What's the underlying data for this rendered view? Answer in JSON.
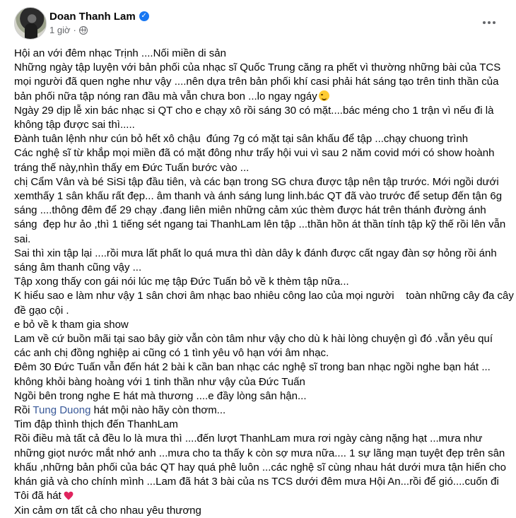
{
  "author": {
    "name": "Doan Thanh Lam",
    "time": "1 giờ",
    "separator": "·"
  },
  "icons": {
    "verified": "verified-badge-icon",
    "privacy": "globe-icon",
    "more": "more-options-icon",
    "wink": "wink-emoji-icon",
    "heart": "red-heart-icon"
  },
  "colors": {
    "link": "#385898",
    "verified": "#1877f2",
    "meta": "#65676b"
  },
  "post": {
    "lines": [
      "Hội an với đêm nhạc Trịnh ....Nối miền di sản",
      "Những ngày tập luyện với bản phối của nhạc sĩ Quốc Trung căng ra phết vì thường những bài của TCS",
      "mọi người đã quen nghe như vậy ....nên dựa trên bản phối khí casi phải hát sáng tạo trên tinh thần của",
      "bản phối nữa tập nóng ran đầu mà vẫn chưa bon ...lo ngay ngáy",
      "Ngày 29 dịp lễ xin bác nhạc si QT cho e chạy xô rồi sáng 30 có mặt....bác méng cho 1 trận vì nếu đi là",
      "không tập được sai thì.....",
      "Đành tuân lệnh như cún bỏ hết xô chậu  đúng 7g có mặt tại sân khấu để tập ...chạy chuong trình",
      "Các nghệ sĩ từ khắp mọi miền đã có mặt đông như trẩy hội vui vì sau 2 năm covid mới có show hoành",
      "tráng thế này,nhìn thấy em Đức Tuấn bước vào ...",
      "chị Cẩm Vân và bé SiSi tập đầu tiên, và các bạn trong SG chưa được tập nên tập trước. Mới ngồi dưới",
      "xemthấy 1 sân khấu rất đẹp... âm thanh và ánh sáng lung linh.bác QT đã vào trước để setup đến tận 6g",
      "sáng ....thông đêm để 29 chạy .đang liên miên những cảm xúc thèm được hát trên thánh đường ánh",
      "sáng  đẹp hư ảo ,thì 1 tiếng sét ngang tai ThanhLam lên tập ...thần hồn át thần tính tập kỹ thế rồi lên vẫn",
      "sai.",
      "Sai thì xin tập lại ....rồi mưa lất phất lo quá mưa thì dàn dây k đánh được cất ngay đàn sợ hỏng rồi ánh",
      "sáng âm thanh cũng vậy ...",
      "Tập xong thấy con gái nói lúc mẹ tập Đức Tuấn bỏ về k thèm tập nữa...",
      "K hiểu sao e làm như vậy 1 sân chơi âm nhạc bao nhiêu công lao của mọi người    toàn những cây đa cây",
      "đề gạo cội .",
      "e bỏ về k tham gia show",
      "Lam về cứ buồn mãi tại sao bây giờ vẫn còn tâm như vậy cho dù k hài lòng chuyện gì đó .vẫn yêu quí",
      "các anh chị đồng nghiệp ai cũng có 1 tình yêu vô hạn với âm nhạc.",
      "Đêm 30 Đức Tuấn vẫn đến hát 2 bài k cần ban nhạc các nghệ sĩ trong ban nhạc ngồi nghe bạn hát ...",
      "không khỏi bàng hoàng với 1 tinh thần như vậy của Đức Tuấn",
      "Ngồi bên trong nghe E hát mà thương ....e đầy lòng sân hận...",
      "Tim đập thình thịch đến ThanhLam",
      "Rồi điều mà tất cả đều lo là mưa thì ....đến lượt ThanhLam mưa rơi ngày càng nặng hạt ...mưa như",
      "những giọt nước mắt nhớ anh ...mưa cho ta thấy k còn sợ mưa nữa.... 1 sự lãng mạn tuyệt đẹp trên sân",
      "khấu ,những bản phối của bác QT hay quá phê luôn ...các nghệ sĩ cùng nhau hát dưới mưa tận hiến cho",
      "khán giả và cho chính mình ...Lam đã hát 3 bài của ns TCS dưới đêm mưa Hội An...rồi để gió....cuốn đi",
      "Tôi đã hát",
      "Xin cảm ơn tất cả cho nhau yêu thương"
    ],
    "mention_line": {
      "prefix": "Rồi ",
      "mention": "Tung Duong",
      "suffix": " hát mội nào hãy còn thơm..."
    }
  }
}
